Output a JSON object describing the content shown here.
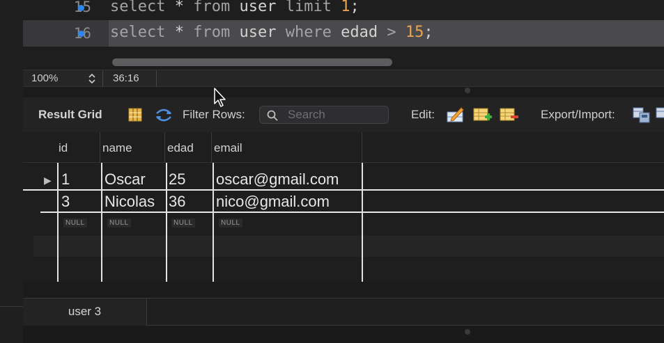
{
  "editor": {
    "lines": [
      {
        "number": "15",
        "kw1": "select",
        "star": " * ",
        "kw2": "from",
        "ident": " user ",
        "kw3": "limit",
        "num": "1",
        "end": ";"
      },
      {
        "number": "16",
        "kw1": "select",
        "star": " * ",
        "kw2": "from",
        "ident": " user ",
        "kw3": "where",
        "rest": " edad ",
        "op": "> ",
        "num": "15",
        "end": ";"
      }
    ]
  },
  "statusbar": {
    "zoom": "100%",
    "cursor_position": "36:16"
  },
  "toolbar": {
    "title": "Result Grid",
    "filter_label": "Filter Rows:",
    "search_placeholder": "Search",
    "edit_label": "Edit:",
    "export_label": "Export/Import:"
  },
  "grid": {
    "columns": [
      "id",
      "name",
      "edad",
      "email"
    ],
    "rows": [
      [
        "1",
        "Oscar",
        "25",
        "oscar@gmail.com"
      ],
      [
        "3",
        "Nicolas",
        "36",
        "nico@gmail.com"
      ]
    ],
    "null_label": "NULL"
  },
  "tabs": {
    "result_tab": "user 3"
  },
  "colors": {
    "breakpoint": "#2f86ea",
    "number": "#e8a351"
  }
}
